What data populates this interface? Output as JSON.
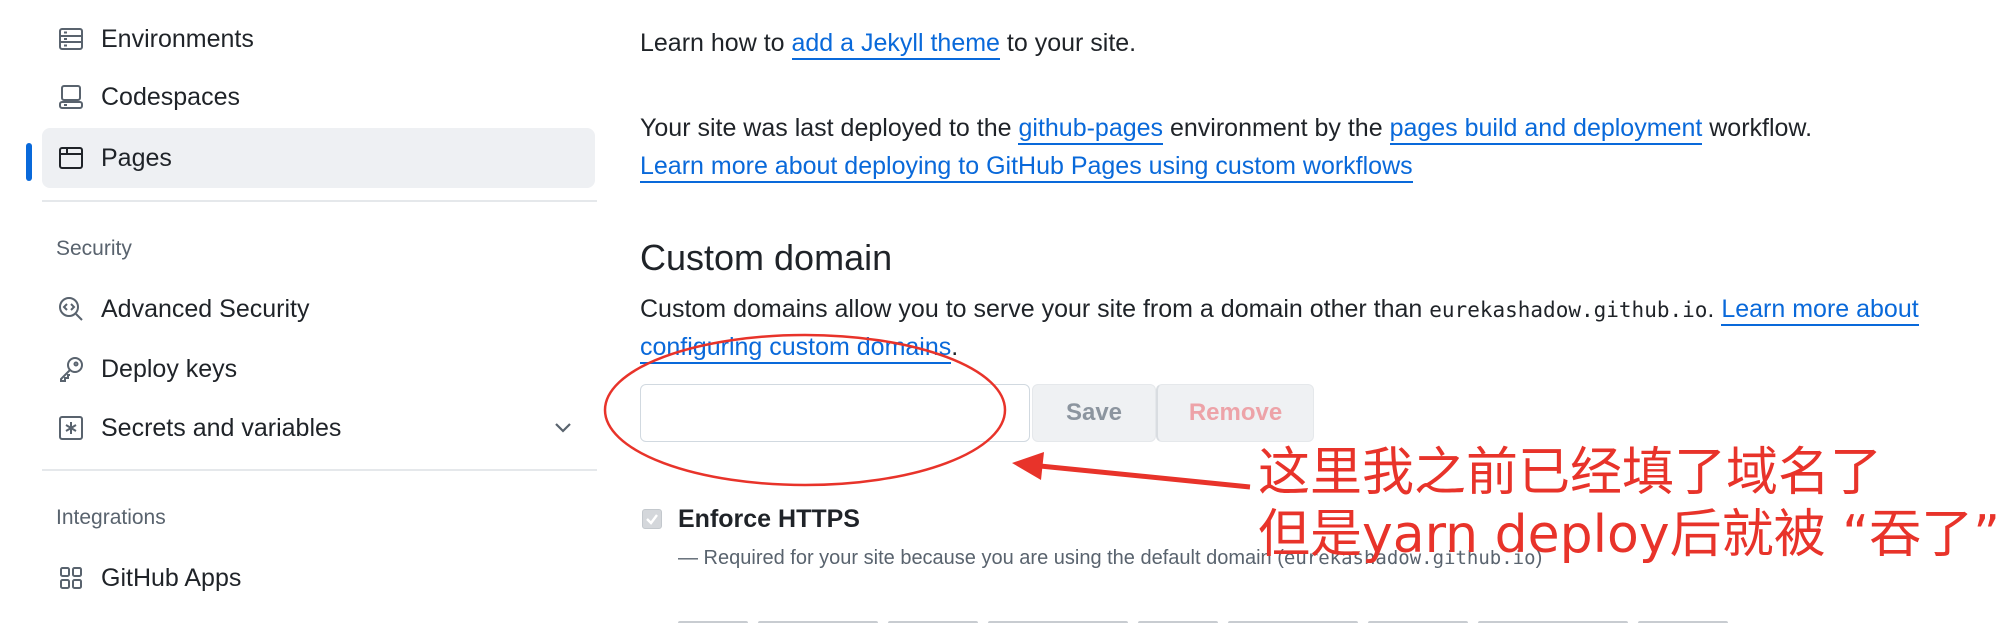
{
  "sidebar": {
    "items": [
      {
        "label": "Environments",
        "icon": "server-icon"
      },
      {
        "label": "Codespaces",
        "icon": "codespaces-icon"
      },
      {
        "label": "Pages",
        "icon": "browser-icon",
        "selected": true
      }
    ],
    "security": {
      "heading": "Security",
      "items": [
        {
          "label": "Advanced Security",
          "icon": "codescan-icon"
        },
        {
          "label": "Deploy keys",
          "icon": "key-icon"
        },
        {
          "label": "Secrets and variables",
          "icon": "asterisk-icon",
          "expandable": true
        }
      ]
    },
    "integrations": {
      "heading": "Integrations",
      "items": [
        {
          "label": "GitHub Apps",
          "icon": "apps-icon"
        }
      ]
    }
  },
  "main": {
    "theme": {
      "prefix": "Learn how to ",
      "link": "add a Jekyll theme",
      "suffix": " to your site."
    },
    "deploy": {
      "prefix": "Your site was last deployed to the ",
      "env_link": "github-pages",
      "middle": " environment by the ",
      "workflow_link": "pages build and deployment",
      "suffix": " workflow.",
      "learn_link": "Learn more about deploying to GitHub Pages using custom workflows"
    },
    "custom_domain": {
      "title": "Custom domain",
      "desc_prefix": "Custom domains allow you to serve your site from a domain other than ",
      "default_domain": "eurekashadow.github.io",
      "desc_dot": ".",
      "learn_link_1": "Learn more about",
      "learn_link_2": "configuring custom domains",
      "desc_end": ".",
      "input_value": "",
      "save_label": "Save",
      "remove_label": "Remove"
    },
    "https": {
      "label": "Enforce HTTPS",
      "checked": true,
      "disabled": true,
      "helper_prefix": "— Required for your site because you are using the default domain (",
      "helper_domain": "eurekashadow.github.io",
      "helper_suffix": ")"
    }
  },
  "annotation": {
    "line1": "这里我之前已经填了域名了",
    "line2": "但是yarn deploy后就被 “吞了”",
    "color": "#e8332a"
  },
  "colors": {
    "accent": "#0969da",
    "selected_bg": "#eef0f3",
    "danger_disabled": "#eda3a8"
  }
}
